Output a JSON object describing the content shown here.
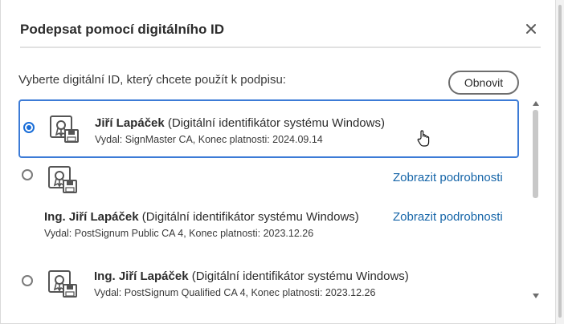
{
  "dialog": {
    "title": "Podepsat pomocí digitálního ID",
    "prompt": "Vyberte digitální ID, který chcete použít k podpisu:",
    "refresh_label": "Obnovit",
    "close_icon": "close-icon"
  },
  "ids": [
    {
      "selected": true,
      "name": "Jiří Lapáček",
      "type": "(Digitální identifikátor systému Windows)",
      "issuer": "Vydal: SignMaster CA, Konec platnosti: 2024.09.14"
    },
    {
      "selected": false,
      "details_link": "Zobrazit podrobnosti"
    },
    {
      "selected": false,
      "name": "Ing. Jiří Lapáček",
      "type": "(Digitální identifikátor systému Windows)",
      "issuer": "Vydal: PostSignum Public CA 4, Konec platnosti: 2023.12.26",
      "details_link": "Zobrazit podrobnosti"
    },
    {
      "selected": false,
      "name": "Ing. Jiří Lapáček",
      "type": "(Digitální identifikátor systému Windows)",
      "issuer": "Vydal: PostSignum Qualified CA 4, Konec platnosti: 2023.12.26"
    }
  ],
  "icons": {
    "certificate": "certificate-icon",
    "cursor": "hand-pointer-icon"
  },
  "colors": {
    "accent": "#1a6ed8",
    "selection_border": "#3c7bd6",
    "link": "#1565a8"
  }
}
